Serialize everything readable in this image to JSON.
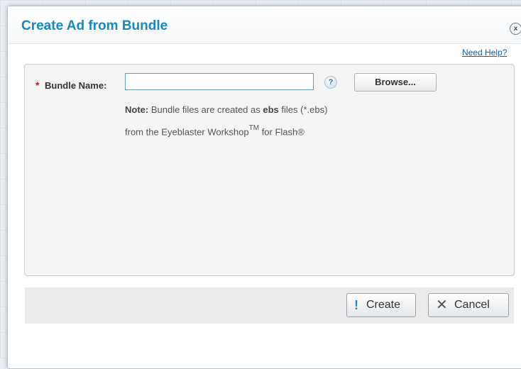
{
  "dialog": {
    "title": "Create Ad from Bundle",
    "close_label": "x",
    "help_link": "Need Help?"
  },
  "form": {
    "required_marker": "*",
    "bundle_label": "Bundle Name:",
    "bundle_value": "",
    "help_icon_text": "?",
    "browse_label": "Browse...",
    "note_prefix": "Note:",
    "note_text_1": " Bundle files are created as ",
    "note_bold": "ebs",
    "note_text_2": " files (*.ebs)",
    "note_line2_pre": "from the Eyeblaster Workshop",
    "note_tm": "TM",
    "note_line2_post": " for Flash®"
  },
  "footer": {
    "create_icon": "!",
    "create_label": "Create",
    "cancel_icon": "✕",
    "cancel_label": "Cancel"
  },
  "colors": {
    "title": "#1a87c0",
    "required": "#d0121b",
    "link": "#1a5f99"
  }
}
